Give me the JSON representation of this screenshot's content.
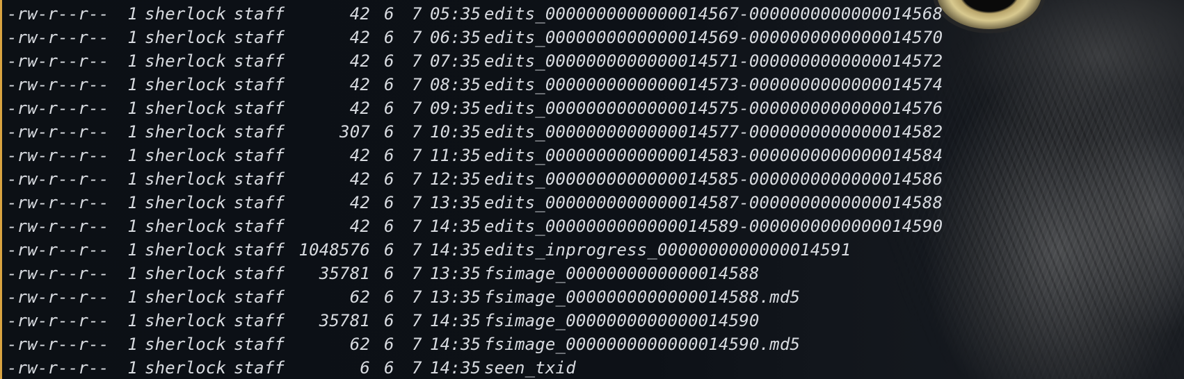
{
  "rows": [
    {
      "perm": "-rw-r--r--",
      "links": "1",
      "owner": "sherlock",
      "group": "staff",
      "size": "42",
      "month": "6",
      "day": "7",
      "time": "05:35",
      "name": "edits_0000000000000014567-0000000000000014568"
    },
    {
      "perm": "-rw-r--r--",
      "links": "1",
      "owner": "sherlock",
      "group": "staff",
      "size": "42",
      "month": "6",
      "day": "7",
      "time": "06:35",
      "name": "edits_0000000000000014569-0000000000000014570"
    },
    {
      "perm": "-rw-r--r--",
      "links": "1",
      "owner": "sherlock",
      "group": "staff",
      "size": "42",
      "month": "6",
      "day": "7",
      "time": "07:35",
      "name": "edits_0000000000000014571-0000000000000014572"
    },
    {
      "perm": "-rw-r--r--",
      "links": "1",
      "owner": "sherlock",
      "group": "staff",
      "size": "42",
      "month": "6",
      "day": "7",
      "time": "08:35",
      "name": "edits_0000000000000014573-0000000000000014574"
    },
    {
      "perm": "-rw-r--r--",
      "links": "1",
      "owner": "sherlock",
      "group": "staff",
      "size": "42",
      "month": "6",
      "day": "7",
      "time": "09:35",
      "name": "edits_0000000000000014575-0000000000000014576"
    },
    {
      "perm": "-rw-r--r--",
      "links": "1",
      "owner": "sherlock",
      "group": "staff",
      "size": "307",
      "month": "6",
      "day": "7",
      "time": "10:35",
      "name": "edits_0000000000000014577-0000000000000014582"
    },
    {
      "perm": "-rw-r--r--",
      "links": "1",
      "owner": "sherlock",
      "group": "staff",
      "size": "42",
      "month": "6",
      "day": "7",
      "time": "11:35",
      "name": "edits_0000000000000014583-0000000000000014584"
    },
    {
      "perm": "-rw-r--r--",
      "links": "1",
      "owner": "sherlock",
      "group": "staff",
      "size": "42",
      "month": "6",
      "day": "7",
      "time": "12:35",
      "name": "edits_0000000000000014585-0000000000000014586"
    },
    {
      "perm": "-rw-r--r--",
      "links": "1",
      "owner": "sherlock",
      "group": "staff",
      "size": "42",
      "month": "6",
      "day": "7",
      "time": "13:35",
      "name": "edits_0000000000000014587-0000000000000014588"
    },
    {
      "perm": "-rw-r--r--",
      "links": "1",
      "owner": "sherlock",
      "group": "staff",
      "size": "42",
      "month": "6",
      "day": "7",
      "time": "14:35",
      "name": "edits_0000000000000014589-0000000000000014590"
    },
    {
      "perm": "-rw-r--r--",
      "links": "1",
      "owner": "sherlock",
      "group": "staff",
      "size": "1048576",
      "month": "6",
      "day": "7",
      "time": "14:35",
      "name": "edits_inprogress_0000000000000014591"
    },
    {
      "perm": "-rw-r--r--",
      "links": "1",
      "owner": "sherlock",
      "group": "staff",
      "size": "35781",
      "month": "6",
      "day": "7",
      "time": "13:35",
      "name": "fsimage_0000000000000014588"
    },
    {
      "perm": "-rw-r--r--",
      "links": "1",
      "owner": "sherlock",
      "group": "staff",
      "size": "62",
      "month": "6",
      "day": "7",
      "time": "13:35",
      "name": "fsimage_0000000000000014588.md5"
    },
    {
      "perm": "-rw-r--r--",
      "links": "1",
      "owner": "sherlock",
      "group": "staff",
      "size": "35781",
      "month": "6",
      "day": "7",
      "time": "14:35",
      "name": "fsimage_0000000000000014590"
    },
    {
      "perm": "-rw-r--r--",
      "links": "1",
      "owner": "sherlock",
      "group": "staff",
      "size": "62",
      "month": "6",
      "day": "7",
      "time": "14:35",
      "name": "fsimage_0000000000000014590.md5"
    },
    {
      "perm": "-rw-r--r--",
      "links": "1",
      "owner": "sherlock",
      "group": "staff",
      "size": "6",
      "month": "6",
      "day": "7",
      "time": "14:35",
      "name": "seen_txid"
    }
  ],
  "colors": {
    "text": "#d8dbe0",
    "background": "#0d1117",
    "accent_border": "#d9a441"
  },
  "background_image": "owl-illustration"
}
